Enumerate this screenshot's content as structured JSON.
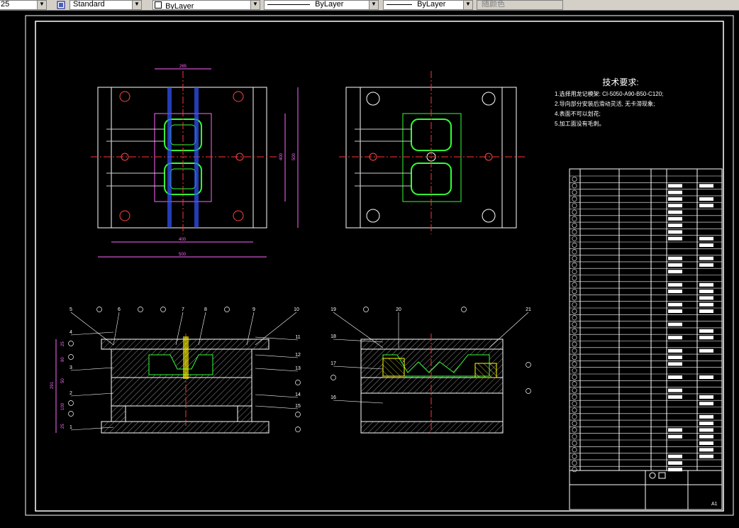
{
  "toolbar": {
    "first_value": "25",
    "text_style": "Standard",
    "layer": "ByLayer",
    "linetype": "ByLayer",
    "lineweight": "ByLayer",
    "color": "随颜色"
  },
  "drawing": {
    "tech_req_title": "技术要求:",
    "tech_req": [
      "1.选择用龙记模架: CI-5050-A90-B50-C120;",
      "2.导向部分安装后滑动灵活, 无卡滞现象;",
      "4.表面不可以划花;",
      "5.加工面没有毛刺。"
    ],
    "dims": {
      "top_width": "265",
      "left_total_width": "500",
      "left_inner_width": "400",
      "left_height": "500",
      "left_inner_height": "400",
      "section_total_height": "291",
      "section_h1": "25",
      "section_h2": "90",
      "section_h3": "50",
      "section_h4": "100",
      "section_h5": "25"
    },
    "left_callouts": [
      "5",
      "6",
      "7",
      "8",
      "9",
      "10",
      "11",
      "12",
      "13",
      "14",
      "15",
      "4",
      "3",
      "2",
      "1"
    ],
    "right_callouts": [
      "19",
      "20",
      "21",
      "18",
      "17",
      "16"
    ],
    "title_block_label": "A1"
  }
}
